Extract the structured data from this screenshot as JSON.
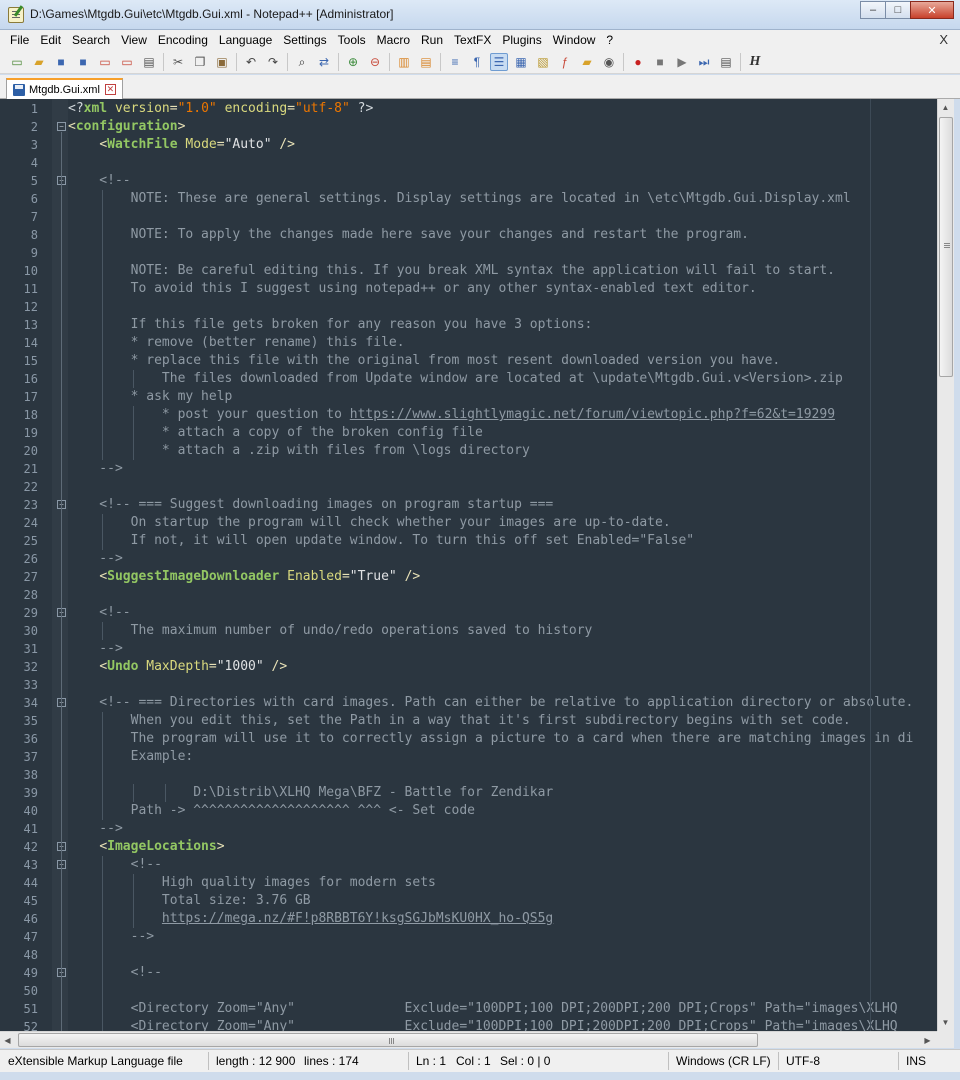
{
  "window": {
    "title": "D:\\Games\\Mtgdb.Gui\\etc\\Mtgdb.Gui.xml - Notepad++ [Administrator]",
    "buttons": {
      "minimize": "–",
      "maximize": "□",
      "close": "✕"
    }
  },
  "menu": {
    "items": [
      "File",
      "Edit",
      "Search",
      "View",
      "Encoding",
      "Language",
      "Settings",
      "Tools",
      "Macro",
      "Run",
      "TextFX",
      "Plugins",
      "Window",
      "?"
    ],
    "close_label": "X"
  },
  "toolbar": {
    "buttons": [
      {
        "name": "new-file-icon",
        "glyph": "▭",
        "color": "#4f8a3a"
      },
      {
        "name": "open-file-icon",
        "glyph": "▰",
        "color": "#d8a22a"
      },
      {
        "name": "save-icon",
        "glyph": "■",
        "color": "#3c67b0"
      },
      {
        "name": "save-all-icon",
        "glyph": "■",
        "color": "#3c67b0"
      },
      {
        "name": "close-file-icon",
        "glyph": "▭",
        "color": "#c84a3a"
      },
      {
        "name": "close-all-icon",
        "glyph": "▭",
        "color": "#c84a3a"
      },
      {
        "name": "print-icon",
        "glyph": "▤",
        "color": "#555555"
      },
      {
        "sep": true
      },
      {
        "name": "cut-icon",
        "glyph": "✂",
        "color": "#555555"
      },
      {
        "name": "copy-icon",
        "glyph": "❐",
        "color": "#555555"
      },
      {
        "name": "paste-icon",
        "glyph": "▣",
        "color": "#8a6a3a"
      },
      {
        "sep": true
      },
      {
        "name": "undo-icon",
        "glyph": "↶",
        "color": "#444444"
      },
      {
        "name": "redo-icon",
        "glyph": "↷",
        "color": "#444444"
      },
      {
        "sep": true
      },
      {
        "name": "find-icon",
        "glyph": "⌕",
        "color": "#333333"
      },
      {
        "name": "replace-icon",
        "glyph": "⇄",
        "color": "#3c67b0"
      },
      {
        "sep": true
      },
      {
        "name": "zoom-in-icon",
        "glyph": "⊕",
        "color": "#3a8a3a"
      },
      {
        "name": "zoom-out-icon",
        "glyph": "⊖",
        "color": "#c84a3a"
      },
      {
        "sep": true
      },
      {
        "name": "sync-vertical-icon",
        "glyph": "▥",
        "color": "#d8862a"
      },
      {
        "name": "sync-horizontal-icon",
        "glyph": "▤",
        "color": "#d8862a"
      },
      {
        "sep": true
      },
      {
        "name": "word-wrap-icon",
        "glyph": "≡",
        "color": "#3c67b0"
      },
      {
        "name": "show-all-chars-icon",
        "glyph": "¶",
        "color": "#3c67b0"
      },
      {
        "name": "indent-guide-icon",
        "glyph": "☰",
        "color": "#3c67b0",
        "active": true
      },
      {
        "name": "udl-icon",
        "glyph": "▦",
        "color": "#3c67b0"
      },
      {
        "name": "doc-map-icon",
        "glyph": "▧",
        "color": "#b8962a"
      },
      {
        "name": "function-list-icon",
        "glyph": "ƒ",
        "color": "#c84a3a"
      },
      {
        "name": "folder-workspace-icon",
        "glyph": "▰",
        "color": "#d8a22a"
      },
      {
        "name": "monitoring-icon",
        "glyph": "◉",
        "color": "#555555"
      },
      {
        "sep": true
      },
      {
        "name": "record-macro-icon",
        "glyph": "●",
        "color": "#c82020"
      },
      {
        "name": "stop-record-icon",
        "glyph": "■",
        "color": "#777777"
      },
      {
        "name": "play-macro-icon",
        "glyph": "▶",
        "color": "#777777"
      },
      {
        "name": "run-macro-multiple-icon",
        "glyph": "⏭",
        "color": "#3c67b0"
      },
      {
        "name": "save-macro-icon",
        "glyph": "▤",
        "color": "#555555"
      },
      {
        "sep": true
      },
      {
        "name": "html-tag-icon",
        "glyph": "H",
        "color": "#333333"
      }
    ]
  },
  "tab": {
    "label": "Mtgdb.Gui.xml",
    "close": "✕"
  },
  "editor": {
    "lines": [
      [
        [
          "c-decl",
          "<?"
        ],
        [
          "c-tagname",
          "xml"
        ],
        [
          "c-text",
          " "
        ],
        [
          "c-attr",
          "version"
        ],
        [
          "c-eq",
          "="
        ],
        [
          "c-str",
          "\"1.0\""
        ],
        [
          "c-text",
          " "
        ],
        [
          "c-attr",
          "encoding"
        ],
        [
          "c-eq",
          "="
        ],
        [
          "c-str",
          "\"utf-8\""
        ],
        [
          "c-text",
          " "
        ],
        [
          "c-decl",
          "?>"
        ]
      ],
      [
        [
          "code-tag",
          "<"
        ],
        [
          "code-tagname",
          "configuration"
        ],
        [
          "code-tag",
          ">"
        ]
      ],
      [
        [
          "c-text",
          "    "
        ],
        [
          "code-tag",
          "<"
        ],
        [
          "code-tagname",
          "WatchFile"
        ],
        [
          "c-text",
          " "
        ],
        [
          "c-attr",
          "Mode"
        ],
        [
          "c-eq",
          "="
        ],
        [
          "c-text",
          "\"Auto\""
        ],
        [
          "c-text",
          " "
        ],
        [
          "code-tag",
          "/>"
        ]
      ],
      [
        [
          "c-text",
          ""
        ]
      ],
      [
        [
          "c-cm",
          "    <!--"
        ]
      ],
      [
        [
          "c-cm",
          "        NOTE: These are general settings. Display settings are located in \\etc\\Mtgdb.Gui.Display.xml"
        ]
      ],
      [
        [
          "c-text",
          ""
        ]
      ],
      [
        [
          "c-cm",
          "        NOTE: To apply the changes made here save your changes and restart the program."
        ]
      ],
      [
        [
          "c-text",
          ""
        ]
      ],
      [
        [
          "c-cm",
          "        NOTE: Be careful editing this. If you break XML syntax the application will fail to start."
        ]
      ],
      [
        [
          "c-cm",
          "        To avoid this I suggest using notepad++ or any other syntax-enabled text editor."
        ]
      ],
      [
        [
          "c-text",
          ""
        ]
      ],
      [
        [
          "c-cm",
          "        If this file gets broken for any reason you have 3 options:"
        ]
      ],
      [
        [
          "c-cm",
          "        * remove (better rename) this file."
        ]
      ],
      [
        [
          "c-cm",
          "        * replace this file with the original from most resent downloaded version you have."
        ]
      ],
      [
        [
          "c-cm",
          "            The files downloaded from Update window are located at \\update\\Mtgdb.Gui.v<Version>.zip"
        ]
      ],
      [
        [
          "c-cm",
          "        * ask my help"
        ]
      ],
      [
        [
          "c-cm",
          "            * post your question to "
        ],
        [
          "c-url",
          "https://www.slightlymagic.net/forum/viewtopic.php?f=62&t=19299"
        ]
      ],
      [
        [
          "c-cm",
          "            * attach a copy of the broken config file"
        ]
      ],
      [
        [
          "c-cm",
          "            * attach a .zip with files from \\logs directory"
        ]
      ],
      [
        [
          "c-cm",
          "    -->"
        ]
      ],
      [
        [
          "c-text",
          ""
        ]
      ],
      [
        [
          "c-cm",
          "    <!-- === Suggest downloading images on program startup ==="
        ]
      ],
      [
        [
          "c-cm",
          "        On startup the program will check whether your images are up-to-date."
        ]
      ],
      [
        [
          "c-cm",
          "        If not, it will open update window. To turn this off set Enabled=\"False\""
        ]
      ],
      [
        [
          "c-cm",
          "    -->"
        ]
      ],
      [
        [
          "c-text",
          "    "
        ],
        [
          "code-tag",
          "<"
        ],
        [
          "code-tagname",
          "SuggestImageDownloader"
        ],
        [
          "c-text",
          " "
        ],
        [
          "c-attr",
          "Enabled"
        ],
        [
          "c-eq",
          "="
        ],
        [
          "c-text",
          "\"True\""
        ],
        [
          "c-text",
          " "
        ],
        [
          "code-tag",
          "/>"
        ]
      ],
      [
        [
          "c-text",
          ""
        ]
      ],
      [
        [
          "c-cm",
          "    <!--"
        ]
      ],
      [
        [
          "c-cm",
          "        The maximum number of undo/redo operations saved to history"
        ]
      ],
      [
        [
          "c-cm",
          "    -->"
        ]
      ],
      [
        [
          "c-text",
          "    "
        ],
        [
          "code-tag",
          "<"
        ],
        [
          "code-tagname",
          "Undo"
        ],
        [
          "c-text",
          " "
        ],
        [
          "c-attr",
          "MaxDepth"
        ],
        [
          "c-eq",
          "="
        ],
        [
          "c-text",
          "\"1000\""
        ],
        [
          "c-text",
          " "
        ],
        [
          "code-tag",
          "/>"
        ]
      ],
      [
        [
          "c-text",
          ""
        ]
      ],
      [
        [
          "c-cm",
          "    <!-- === Directories with card images. Path can either be relative to application directory or absolute."
        ]
      ],
      [
        [
          "c-cm",
          "        When you edit this, set the Path in a way that it's first subdirectory begins with set code."
        ]
      ],
      [
        [
          "c-cm",
          "        The program will use it to correctly assign a picture to a card when there are matching images in di"
        ]
      ],
      [
        [
          "c-cm",
          "        Example:"
        ]
      ],
      [
        [
          "c-text",
          ""
        ]
      ],
      [
        [
          "c-cm",
          "                D:\\Distrib\\XLHQ Mega\\BFZ - Battle for Zendikar"
        ]
      ],
      [
        [
          "c-cm",
          "        Path -> ^^^^^^^^^^^^^^^^^^^^ ^^^ <- Set code"
        ]
      ],
      [
        [
          "c-cm",
          "    -->"
        ]
      ],
      [
        [
          "c-text",
          "    "
        ],
        [
          "code-tag",
          "<"
        ],
        [
          "code-tagname",
          "ImageLocations"
        ],
        [
          "code-tag",
          ">"
        ]
      ],
      [
        [
          "c-cm",
          "        <!--"
        ]
      ],
      [
        [
          "c-cm",
          "            High quality images for modern sets"
        ]
      ],
      [
        [
          "c-cm",
          "            Total size: 3.76 GB"
        ]
      ],
      [
        [
          "c-cm",
          "            "
        ],
        [
          "c-url",
          "https://mega.nz/#F!p8RBBT6Y!ksgSGJbMsKU0HX_ho-QS5g"
        ]
      ],
      [
        [
          "c-cm",
          "        -->"
        ]
      ],
      [
        [
          "c-text",
          ""
        ]
      ],
      [
        [
          "c-cm",
          "        <!--"
        ]
      ],
      [
        [
          "c-text",
          ""
        ]
      ],
      [
        [
          "c-cm",
          "        <Directory Zoom=\"Any\"              Exclude=\"100DPI;100 DPI;200DPI;200 DPI;Crops\" Path=\"images\\XLHQ"
        ]
      ],
      [
        [
          "c-cm",
          "        <Directory Zoom=\"Any\"              Exclude=\"100DPI;100 DPI;200DPI;200 DPI;Crops\" Path=\"images\\XLHQ"
        ]
      ]
    ],
    "fold_rows": [
      2,
      5,
      23,
      29,
      34,
      42,
      43,
      49
    ]
  },
  "status": {
    "file_type": "eXtensible Markup Language file",
    "length": "length : 12 900",
    "lines": "lines : 174",
    "ln": "Ln : 1",
    "col": "Col : 1",
    "sel": "Sel : 0 | 0",
    "eol": "Windows (CR LF)",
    "encoding": "UTF-8",
    "mode": "INS"
  }
}
